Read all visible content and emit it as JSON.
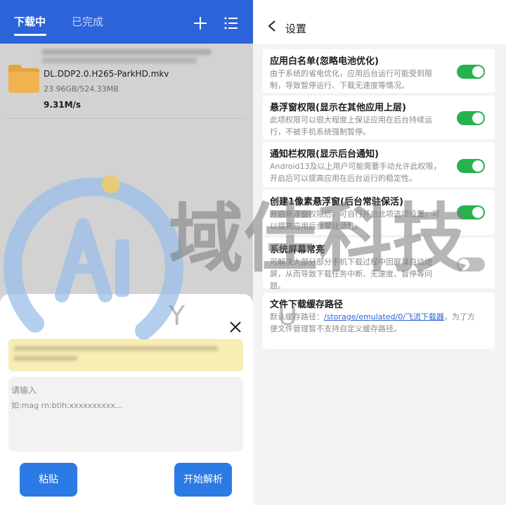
{
  "left": {
    "tabs": [
      {
        "label": "下载中",
        "active": true
      },
      {
        "label": "已完成",
        "active": false
      }
    ],
    "toolbar_icons": [
      "add-icon",
      "menu-list-icon"
    ],
    "download": {
      "file_name": "DL.DDP2.0.H265-ParkHD.mkv",
      "size": "23.96GB/524.33MB",
      "speed": "9.31M/s"
    },
    "dialog": {
      "input_placeholder_line1": "请输入",
      "input_placeholder_line2": "如:mag                  rn:btih:xxxxxxxxxx...",
      "paste_button": "粘贴",
      "parse_button": "开始解析"
    }
  },
  "right": {
    "title": "设置",
    "settings": [
      {
        "title": "应用白名单(忽略电池优化)",
        "desc": "由于系统的省电优化，应用后台运行可能受到限制，导致暂停运行、下载无速度等情况。",
        "enabled": true
      },
      {
        "title": "悬浮窗权限(显示在其他应用上层)",
        "desc": "此项权限可以很大程度上保证应用在后台持续运行，不被手机系统强制暂停。",
        "enabled": true
      },
      {
        "title": "通知栏权限(显示后台通知)",
        "desc": "Android13及以上用户可能需要手动允许此权限，开启后可以提高应用在后台运行的稳定性。",
        "enabled": true
      },
      {
        "title": "创建1像素悬浮窗(后台常驻保活)",
        "desc": "开启悬浮窗权限后，可自行开启此项选项设置，可以提高应用后台常驻活性。",
        "enabled": true
      },
      {
        "title": "系统屏幕常亮",
        "desc": "可解决大部分部分手机下载过程中因屏幕自动熄屏，从而导致下载任务中断、无速度、暂停等问题。",
        "enabled": false
      }
    ],
    "storage": {
      "title": "文件下载缓存路径",
      "desc_prefix": "默认缓存路径：",
      "path": "/storage/emulated/0/飞流下载器",
      "desc_suffix": "，为了方便文件管理暂不支持自定义缓存路径。"
    }
  },
  "watermark": {
    "logo_letters": "Ai",
    "text": "域佳科技",
    "subtext": "Y U",
    "color": "#2c7be5"
  }
}
